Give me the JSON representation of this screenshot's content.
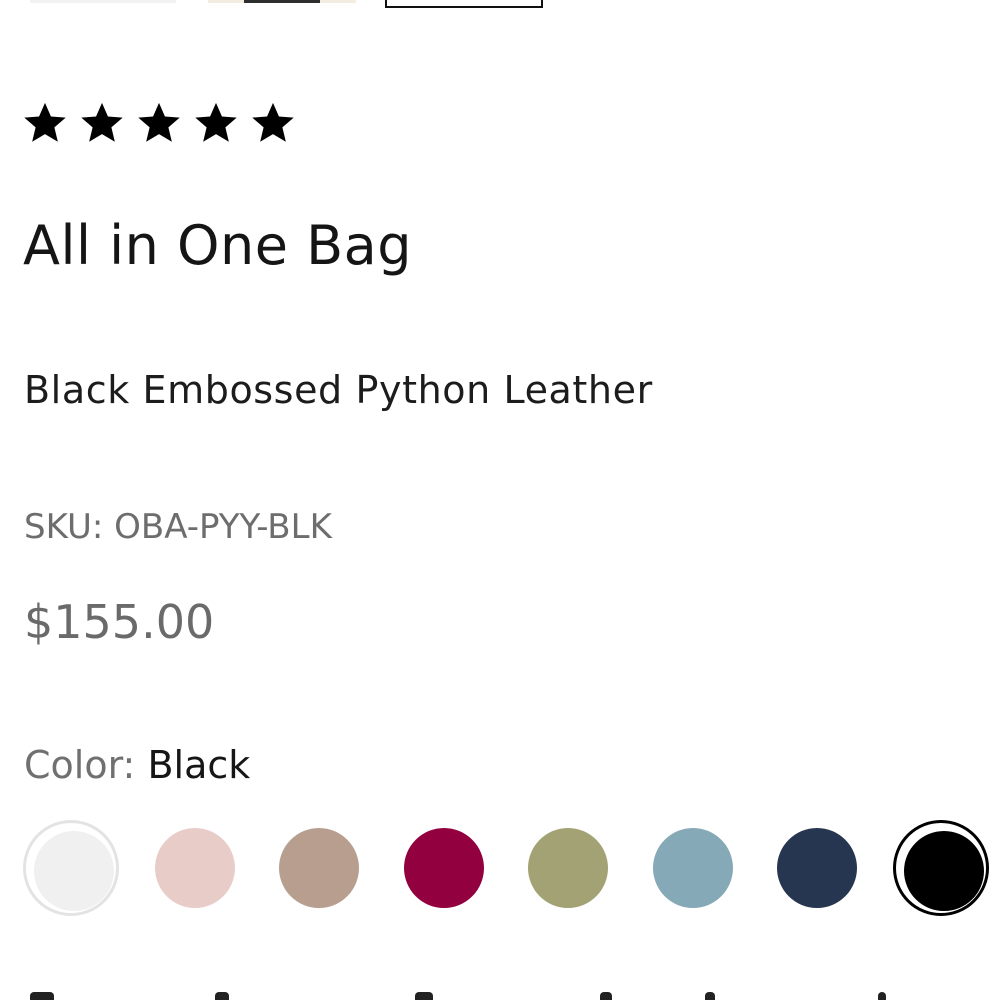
{
  "rating": {
    "stars": 5,
    "max": 5
  },
  "product": {
    "title": "All in One Bag",
    "subtitle": "Black Embossed Python Leather",
    "sku_label": "SKU:",
    "sku": "OBA-PYY-BLK",
    "price": "$155.00"
  },
  "color": {
    "label": "Color:",
    "selected": "Black",
    "swatches": [
      {
        "name": "white",
        "hex": "#f0f0f0"
      },
      {
        "name": "blush",
        "hex": "#e8ccc7"
      },
      {
        "name": "taupe",
        "hex": "#b79e8f"
      },
      {
        "name": "berry",
        "hex": "#930040"
      },
      {
        "name": "olive",
        "hex": "#a2a274"
      },
      {
        "name": "light-blue",
        "hex": "#86a9b7"
      },
      {
        "name": "navy",
        "hex": "#263550"
      },
      {
        "name": "black",
        "hex": "#000000"
      }
    ]
  }
}
